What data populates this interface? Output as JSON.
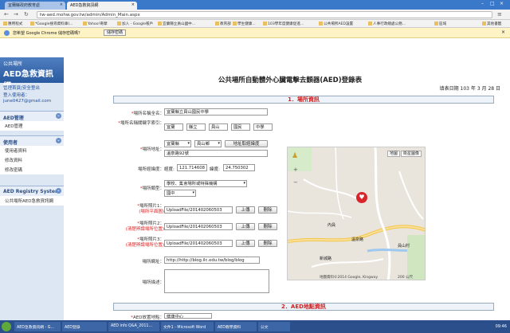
{
  "browser": {
    "tabs": [
      {
        "label": "宜蘭縣政府教育處"
      },
      {
        "label": "AED急救資訊網"
      }
    ],
    "url": "tw-aed.mohw.gov.tw/admin/Admin_Main.aspx",
    "bookmarks": [
      "應用程式",
      "*Google搜尋資料庫(...",
      "Yahoo!奇摩",
      "加入 - Google帳戶",
      "宜蘭縣立員山國中...",
      "教育部",
      "學生健康...",
      "103學年度健康促進...",
      "公共場所AED設置",
      "人事行政總處公務...",
      "區域",
      "其他書籤"
    ],
    "infobar": {
      "text": "您希望 Google Chrome 儲存密碼嗎？",
      "button": "儲存密碼"
    }
  },
  "sidebar": {
    "site_small": "公共場所",
    "site_big": "AED急救資訊網",
    "links": [
      "管理首頁|安全登出",
      "登入使用者：",
      "june0427@gmail.com"
    ],
    "sections": [
      {
        "title": "AED管理",
        "items": [
          "AED管理"
        ]
      },
      {
        "title": "使用者",
        "items": [
          "使用者資料",
          "修改資料",
          "修改密碼"
        ]
      },
      {
        "title": "AED Registry System",
        "items": [
          "公共場所AED急救資訊網"
        ]
      }
    ]
  },
  "form": {
    "title": "公共場所自動體外心臟電擊去顫器(AED)登錄表",
    "date": "填表日期 103 年 3 月 28 日",
    "section1": "1．場所資訊",
    "section2": "2．AED地點資訊",
    "labels": {
      "name": "場所名稱全名：",
      "keyword": "場所名稱關鍵字索引：",
      "address": "場所地址：",
      "coords": "場所經緯度：",
      "type": "場所類型：",
      "photo1": "場所照片1：",
      "photo1_note": "(場所平面圖)",
      "photo2": "場所照片2：",
      "photo2_note": "(清楚辨識場所位置)",
      "photo3": "場所照片3：",
      "photo3_note": "(清楚辨識場所位置)",
      "website": "場所網址：",
      "desc": "場所描述：",
      "aed_place": "AED放置地點："
    },
    "values": {
      "name": "宜蘭縣立員山國民中學",
      "keywords": [
        "宜蘭",
        "縣立",
        "員山",
        "國民",
        "中學"
      ],
      "county": "宜蘭縣",
      "town": "員山鄉",
      "street": "溫泉路92號",
      "lng_label": "經度:",
      "lng": "121.714608",
      "lat_label": "緯度:",
      "lat": "24.750302",
      "type1": "學校、集會場所或特殊機構",
      "type2": "國中",
      "photo1": "UploadFile/201402060503",
      "photo2": "UploadFile/201402060503",
      "photo3": "UploadFile/201402060503",
      "website": "http://http://blog.ilc.edu.tw/blog/blog",
      "aed_place": "健康中心"
    },
    "buttons": {
      "geocode": "地址取經緯度",
      "upload": "上傳",
      "delete": "刪除"
    },
    "map": {
      "map_btn": "地圖",
      "sat_btn": "衛星圖像",
      "copyright": "地圖資料©2014 Google, Kingway",
      "scale": "200 公尺",
      "labels": [
        "內員",
        "溫泉路",
        "員山村",
        "新城路"
      ]
    }
  },
  "taskbar": {
    "items": [
      "AED急救資訊網 - G...",
      "AED登錄",
      "AED info Q&A_2011...",
      "文件1 - Microsoft Word",
      "AED教學資料",
      "公文"
    ],
    "clock": "09:46"
  },
  "colors": {
    "header_blue": "#2a5aa0",
    "required_red": "#d22222",
    "sidebar_bg": "#dde7f3"
  }
}
